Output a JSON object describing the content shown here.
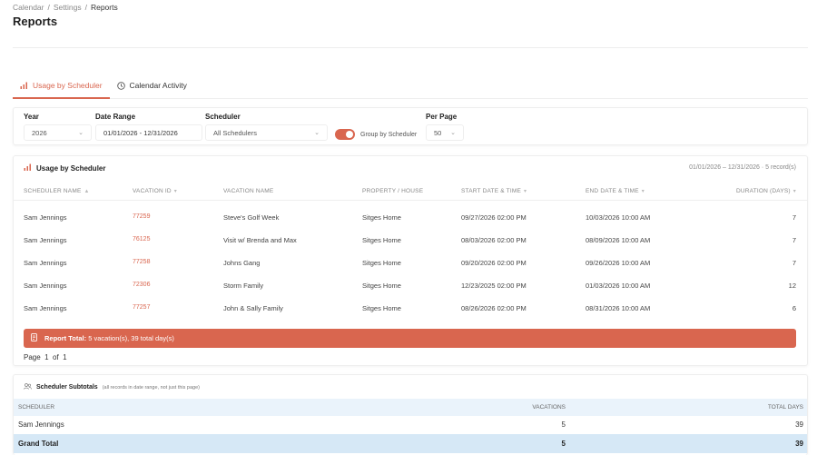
{
  "breadcrumb": {
    "items": [
      "Calendar",
      "Settings"
    ],
    "current": "Reports"
  },
  "page_title": "Reports",
  "tabs": [
    {
      "label": "Usage by Scheduler",
      "icon": "bar-chart-icon",
      "active": true
    },
    {
      "label": "Calendar Activity",
      "icon": "clock-icon",
      "active": false
    }
  ],
  "filters": {
    "year": {
      "label": "Year",
      "value": "2026"
    },
    "date_range": {
      "label": "Date Range",
      "value": "01/01/2026 - 12/31/2026"
    },
    "scheduler": {
      "label": "Scheduler",
      "value": "All Schedulers"
    },
    "group_toggle": {
      "label": "Group by Scheduler",
      "on": true
    },
    "per_page": {
      "label": "Per Page",
      "value": "50"
    }
  },
  "usage": {
    "title": "Usage by Scheduler",
    "meta": "01/01/2026 – 12/31/2026 · 5 record(s)",
    "columns": [
      "SCHEDULER NAME",
      "VACATION ID",
      "VACATION NAME",
      "PROPERTY / HOUSE",
      "START DATE & TIME",
      "END DATE & TIME",
      "DURATION (DAYS)"
    ],
    "rows": [
      [
        "Sam Jennings",
        "77259",
        "Steve's Golf Week",
        "Sitges Home",
        "09/27/2026 02:00 PM",
        "10/03/2026 10:00 AM",
        "7"
      ],
      [
        "Sam Jennings",
        "76125",
        "Visit w/ Brenda and Max",
        "Sitges Home",
        "08/03/2026 02:00 PM",
        "08/09/2026 10:00 AM",
        "7"
      ],
      [
        "Sam Jennings",
        "77258",
        "Johns Gang",
        "Sitges Home",
        "09/20/2026 02:00 PM",
        "09/26/2026 10:00 AM",
        "7"
      ],
      [
        "Sam Jennings",
        "72306",
        "Storm Family",
        "Sitges Home",
        "12/23/2025 02:00 PM",
        "01/03/2026 10:00 AM",
        "12"
      ],
      [
        "Sam Jennings",
        "77257",
        "John & Sally Family",
        "Sitges Home",
        "08/26/2026 02:00 PM",
        "08/31/2026 10:00 AM",
        "6"
      ]
    ],
    "total_label": "Report Total:",
    "total_value": "5 vacation(s), 39 total day(s)",
    "page_text": "Page  1  of  1"
  },
  "subtotals": {
    "title": "Scheduler Subtotals",
    "note": "(all records in date range, not just this page)",
    "columns": [
      "SCHEDULER",
      "VACATIONS",
      "TOTAL DAYS"
    ],
    "rows": [
      [
        "Sam Jennings",
        "5",
        "39"
      ]
    ],
    "grand": [
      "Grand Total",
      "5",
      "39"
    ]
  },
  "colors": {
    "accent": "#d9664f",
    "subtotal_header": "#eaf3fb",
    "grand_total": "#d6e8f6"
  }
}
